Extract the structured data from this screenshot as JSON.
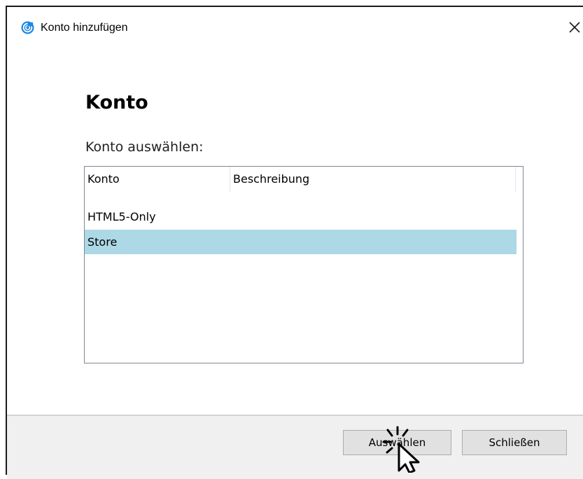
{
  "window": {
    "title": "Konto hinzufügen",
    "app_icon": "refresh-swirl-icon",
    "close_icon": "close-icon"
  },
  "main": {
    "heading": "Konto",
    "subheading": "Konto auswählen:"
  },
  "listview": {
    "columns": [
      "Konto",
      "Beschreibung"
    ],
    "rows": [
      {
        "konto": "HTML5-Only",
        "beschreibung": ""
      },
      {
        "konto": "Store",
        "beschreibung": "",
        "selected": true
      }
    ],
    "selected_color": "#add8e6"
  },
  "footer": {
    "select_label": "Auswählen",
    "close_label": "Schließen"
  },
  "colors": {
    "accent": "#0078d7",
    "footer_bg": "#f0f0f0",
    "button_bg": "#e1e1e1"
  },
  "cursor": "click-pointer-icon"
}
